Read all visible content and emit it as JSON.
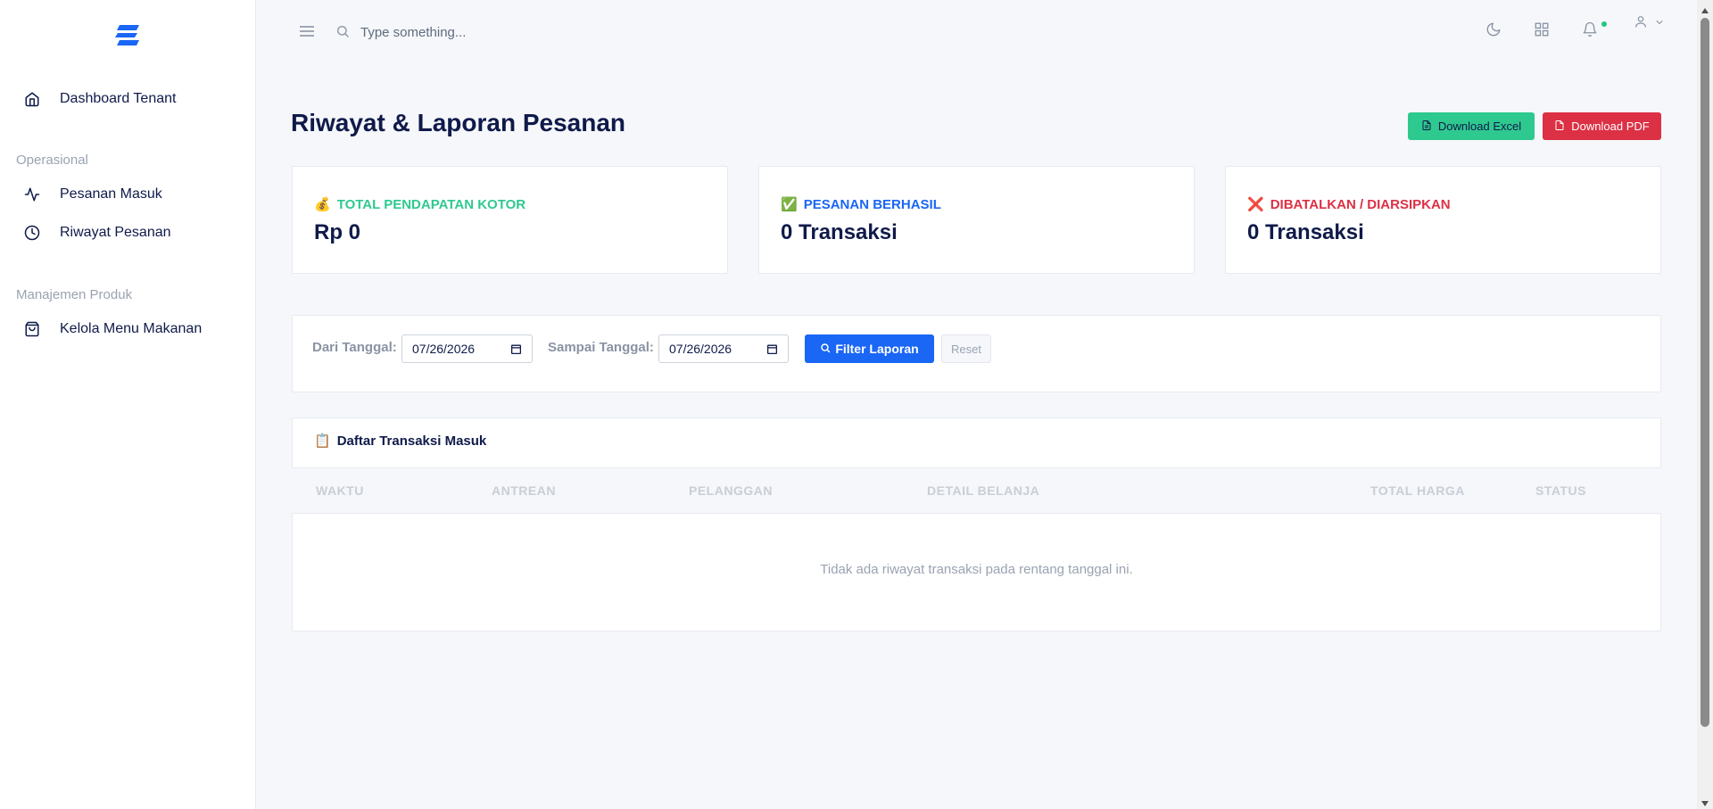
{
  "sidebar": {
    "logo_icon": "brand-logo-icon",
    "items": [
      {
        "label": "Dashboard Tenant",
        "icon": "home-icon"
      },
      {
        "label": "Pesanan Masuk",
        "icon": "activity-icon"
      },
      {
        "label": "Riwayat Pesanan",
        "icon": "clock-icon"
      },
      {
        "label": "Kelola Menu Makanan",
        "icon": "shopping-bag-icon"
      }
    ],
    "sections": [
      "Operasional",
      "Manajemen Produk"
    ]
  },
  "topbar": {
    "search_placeholder": "Type something...",
    "icons": [
      "menu-icon",
      "search-icon",
      "moon-icon",
      "grid-icon",
      "bell-icon",
      "user-icon",
      "chevron-down-icon"
    ]
  },
  "page": {
    "title": "Riwayat & Laporan Pesanan",
    "btn_excel": "Download Excel",
    "btn_pdf": "Download PDF"
  },
  "stats": [
    {
      "emoji": "💰",
      "label": "TOTAL PENDAPATAN KOTOR",
      "value": "Rp 0",
      "color": "#2ec98f"
    },
    {
      "emoji": "✅",
      "label": "PESANAN BERHASIL",
      "value": "0 Transaksi",
      "color": "#1a66f5"
    },
    {
      "emoji": "❌",
      "label": "DIBATALKAN / DIARSIPKAN",
      "value": "0 Transaksi",
      "color": "#dc3045"
    }
  ],
  "filter": {
    "from_label": "Dari Tanggal:",
    "from_value": "07/26/2026",
    "to_label": "Sampai Tanggal:",
    "to_value": "07/26/2026",
    "filter_button": "Filter Laporan",
    "reset_button": "Reset"
  },
  "table": {
    "title_emoji": "📋",
    "title": "Daftar Transaksi Masuk",
    "columns": [
      "WAKTU",
      "ANTREAN",
      "PELANGGAN",
      "DETAIL BELANJA",
      "TOTAL HARGA",
      "STATUS"
    ],
    "empty_message": "Tidak ada riwayat transaksi pada rentang tanggal ini."
  },
  "colors": {
    "accent": "#1a66f5",
    "success": "#2ec98f",
    "danger": "#dc3045",
    "text": "#0f1a4a"
  }
}
